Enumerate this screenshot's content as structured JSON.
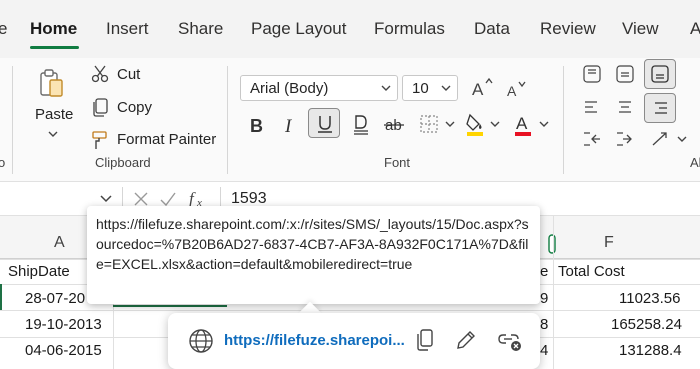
{
  "tabs": [
    {
      "label": "e"
    },
    {
      "label": "Home",
      "active": true
    },
    {
      "label": "Insert"
    },
    {
      "label": "Share"
    },
    {
      "label": "Page Layout"
    },
    {
      "label": "Formulas"
    },
    {
      "label": "Data"
    },
    {
      "label": "Review"
    },
    {
      "label": "View"
    },
    {
      "label": "Au"
    }
  ],
  "ribbon": {
    "clipboard": {
      "paste_label": "Paste",
      "cut_label": "Cut",
      "copy_label": "Copy",
      "format_painter_label": "Format Painter",
      "group_label": "Clipboard"
    },
    "font": {
      "font_name": "Arial (Body)",
      "font_size": "10",
      "group_label": "Font",
      "highlight_color": "#ffd400",
      "font_color": "#e81123"
    },
    "left_cut_label": "o",
    "right_cut_label": "Al"
  },
  "formula_bar": {
    "value": "1593"
  },
  "grid": {
    "column_headers": [
      "A",
      "F"
    ],
    "header_row": {
      "a": "ShipDate",
      "e_partial": "e",
      "f": "Total Cost"
    },
    "rows": [
      {
        "a": "28-07-20",
        "e_partial": "9",
        "f": "11023.56"
      },
      {
        "a": "19-10-2013",
        "e_partial": "8",
        "f": "165258.24"
      },
      {
        "a": "04-06-2015",
        "e_partial": "4",
        "f": "131288.4"
      }
    ]
  },
  "tooltip": {
    "text": "https://filefuze.sharepoint.com/:x:/r/sites/SMS/_layouts/15/Doc.aspx?sourcedoc=%7B20B6AD27-6837-4CB7-AF3A-8A932F0C171A%7D&file=EXCEL.xlsx&action=default&mobileredirect=true"
  },
  "link_card": {
    "url_display": "https://filefuze.sharepoi..."
  },
  "colors": {
    "accent": "#107c41",
    "link": "#0f6cbd",
    "selection": "#1e7145"
  }
}
